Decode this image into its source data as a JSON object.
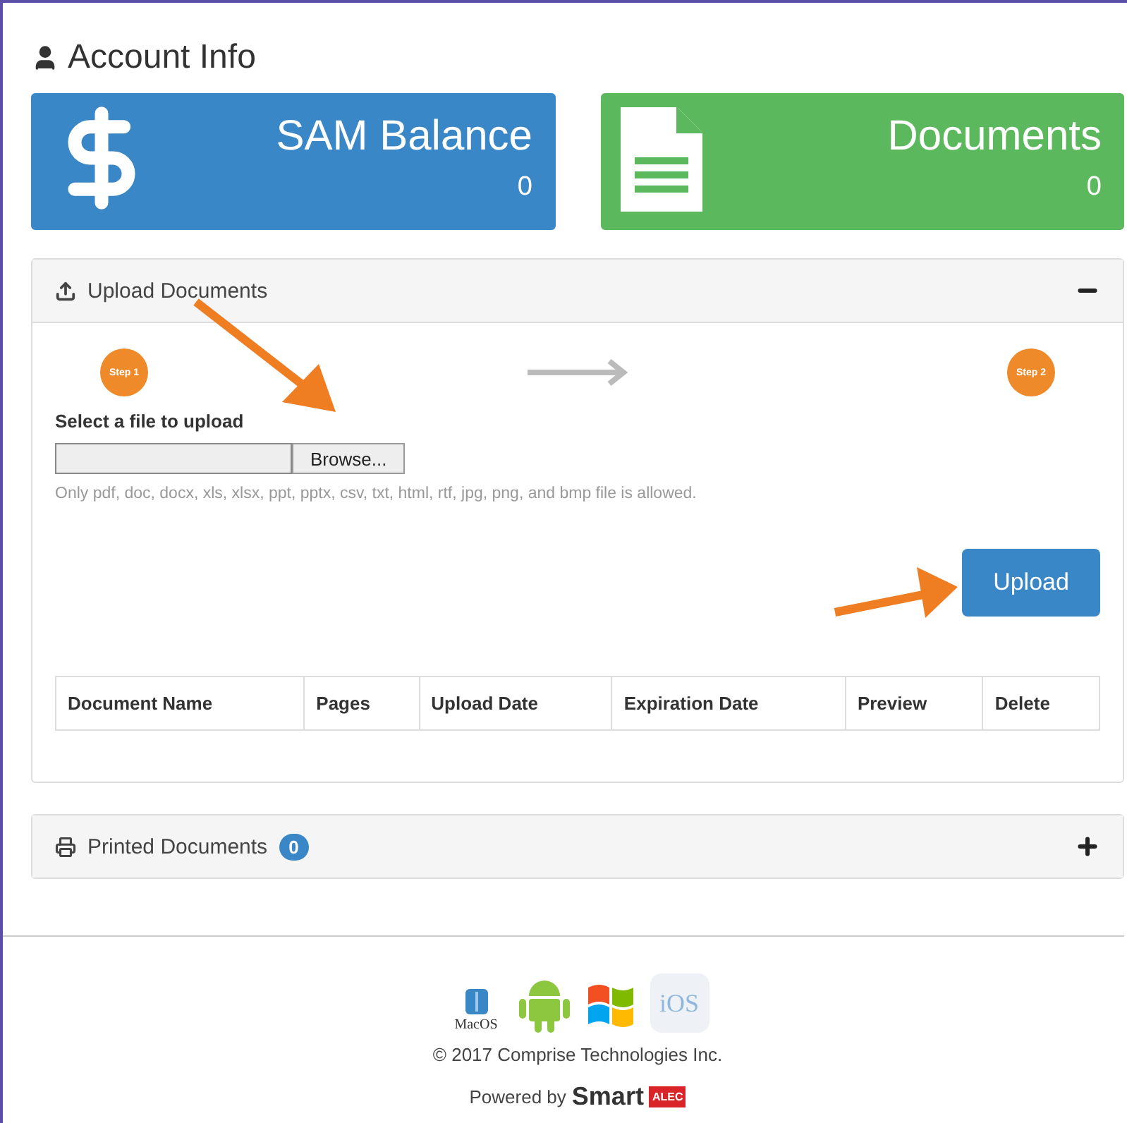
{
  "page_title": "Account Info",
  "cards": [
    {
      "kind": "balance",
      "title": "SAM Balance",
      "value": "0",
      "color": "#3a87c8"
    },
    {
      "kind": "documents",
      "title": "Documents",
      "value": "0",
      "color": "#5cb85c"
    }
  ],
  "upload_panel": {
    "title": "Upload Documents",
    "expanded": true,
    "steps": [
      {
        "label": "Step 1"
      },
      {
        "label": "Step 2"
      }
    ],
    "file_label": "Select a file to upload",
    "browse_button": "Browse...",
    "hint": "Only pdf, doc, docx, xls, xlsx, ppt, pptx, csv, txt, html, rtf, jpg, png, and bmp file is allowed.",
    "upload_button": "Upload",
    "table": {
      "columns": [
        "Document Name",
        "Pages",
        "Upload Date",
        "Expiration Date",
        "Preview",
        "Delete"
      ]
    }
  },
  "printed_panel": {
    "title": "Printed Documents",
    "count": "0",
    "expanded": false
  },
  "footer": {
    "platforms": [
      {
        "kind": "mac",
        "label": "MacOS"
      },
      {
        "kind": "android"
      },
      {
        "kind": "windows"
      },
      {
        "kind": "ios",
        "label": "iOS"
      }
    ],
    "copyright": "© 2017 Comprise Technologies Inc.",
    "powered_by": "Powered by",
    "brand": "Smart",
    "brand_tag": "ALEC"
  }
}
